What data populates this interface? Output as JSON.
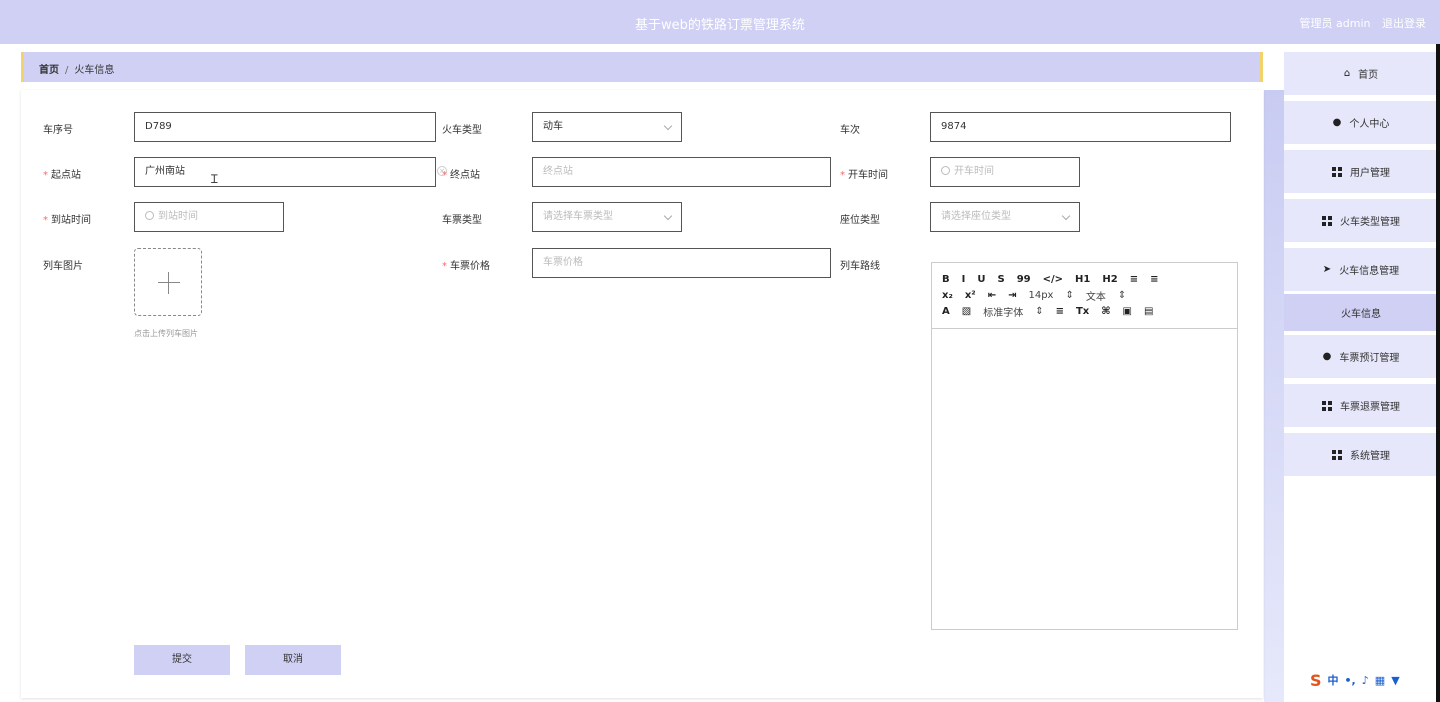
{
  "header": {
    "title": "基于web的铁路订票管理系统",
    "user_label": "管理员 admin",
    "logout": "退出登录"
  },
  "breadcrumb": {
    "home": "首页",
    "separator": "/",
    "current": "火车信息"
  },
  "form": {
    "train_seq": {
      "label": "车序号",
      "value": "D789"
    },
    "train_type": {
      "label": "火车类型",
      "value": "动车"
    },
    "train_no": {
      "label": "车次",
      "value": "9874"
    },
    "start_station": {
      "label": "起点站",
      "value": "广州南站"
    },
    "end_station": {
      "label": "终点站",
      "placeholder": "终点站"
    },
    "depart_time": {
      "label": "开车时间",
      "placeholder": "开车时间"
    },
    "arrive_time": {
      "label": "到站时间",
      "placeholder": "到站时间"
    },
    "ticket_type": {
      "label": "车票类型",
      "placeholder": "请选择车票类型"
    },
    "seat_type": {
      "label": "座位类型",
      "placeholder": "请选择座位类型"
    },
    "train_image": {
      "label": "列车图片",
      "tip": "点击上传列车图片"
    },
    "ticket_price": {
      "label": "车票价格",
      "placeholder": "车票价格"
    },
    "train_route": {
      "label": "列车路线"
    },
    "submit": "提交",
    "cancel": "取消"
  },
  "editor_toolbar": {
    "row1": [
      "B",
      "I",
      "U",
      "S",
      "99",
      "</>",
      "H1",
      "H2",
      "≡",
      "≡"
    ],
    "row2": [
      "x₂",
      "x²",
      "⇤",
      "⇥",
      "14px",
      "⇕",
      "文本",
      "⇕"
    ],
    "row3": [
      "A",
      "▧",
      "标准字体",
      "⇕",
      "≡",
      "Tx",
      "⌘",
      "▣",
      "▤"
    ]
  },
  "sidebar": {
    "items": [
      {
        "label": "首页",
        "icon": "home-icon"
      },
      {
        "label": "个人中心",
        "icon": "person-icon"
      },
      {
        "label": "用户管理",
        "icon": "grid-icon"
      },
      {
        "label": "火车类型管理",
        "icon": "grid-icon"
      },
      {
        "label": "火车信息管理",
        "icon": "send-icon"
      },
      {
        "label": "火车信息",
        "icon": ""
      },
      {
        "label": "车票预订管理",
        "icon": "person-icon"
      },
      {
        "label": "车票退票管理",
        "icon": "grid-icon"
      },
      {
        "label": "系统管理",
        "icon": "grid-icon"
      }
    ]
  },
  "ime": {
    "logo": "S",
    "mode": "中"
  },
  "colors": {
    "accent": "#cfd0f4",
    "border_accent": "#f2d36b",
    "required": "#f56c6c"
  }
}
